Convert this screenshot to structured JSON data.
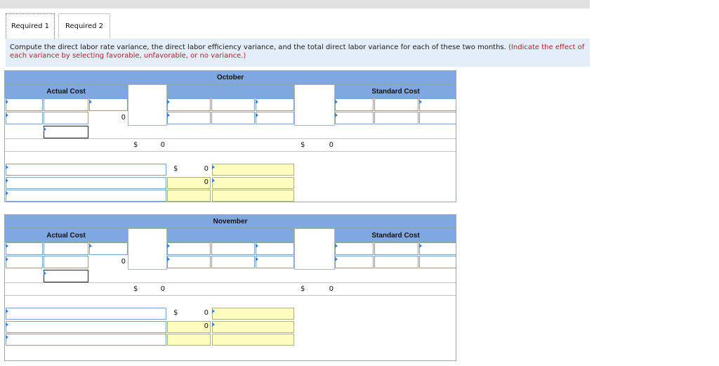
{
  "tabs": [
    {
      "label": "Required 1",
      "active": true
    },
    {
      "label": "Required 2",
      "active": false
    }
  ],
  "instructions": {
    "main": "Compute the direct labor rate variance, the direct labor efficiency variance, and the total direct labor variance for each of these two months.",
    "note": "(Indicate the effect of each variance by selecting favorable, unfavorable, or no variance.)"
  },
  "months": [
    {
      "title": "October",
      "actual_cost_label": "Actual Cost",
      "standard_cost_label": "Standard Cost",
      "actual_total": "0",
      "dollar": "$",
      "left_total": "0",
      "right_total": "0",
      "rate_variance": "0",
      "efficiency_variance": "0"
    },
    {
      "title": "November",
      "actual_cost_label": "Actual Cost",
      "standard_cost_label": "Standard Cost",
      "actual_total": "0",
      "dollar": "$",
      "left_total": "0",
      "right_total": "0",
      "rate_variance": "0",
      "efficiency_variance": "0"
    }
  ],
  "colors": {
    "header_blue": "#7fa8e3",
    "yellow_input": "#fffcc0",
    "red_note": "#b5212b"
  }
}
